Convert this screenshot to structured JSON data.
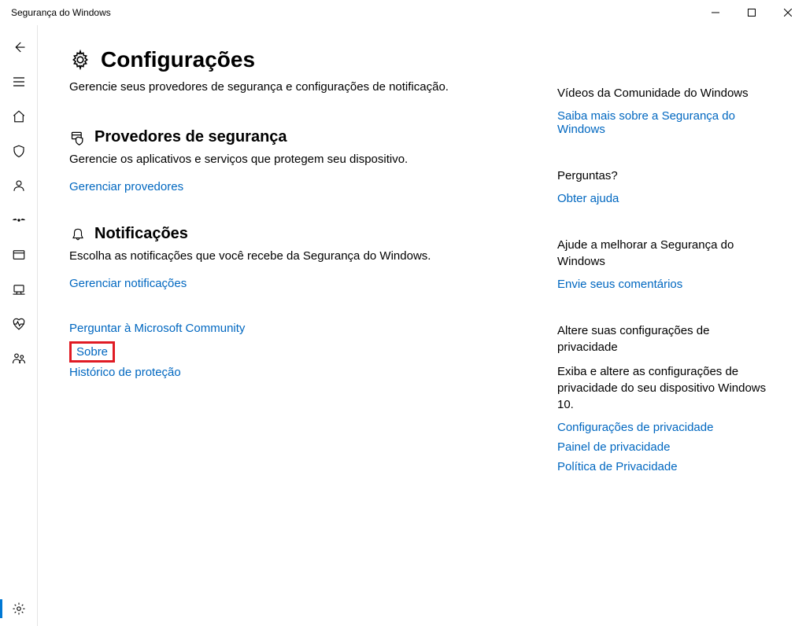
{
  "window": {
    "title": "Segurança do Windows"
  },
  "page": {
    "title": "Configurações",
    "description": "Gerencie seus provedores de segurança e configurações de notificação."
  },
  "sections": {
    "providers": {
      "heading": "Provedores de segurança",
      "description": "Gerencie os aplicativos e serviços que protegem seu dispositivo.",
      "link": "Gerenciar provedores"
    },
    "notifications": {
      "heading": "Notificações",
      "description": "Escolha as notificações que você recebe da Segurança do Windows.",
      "link": "Gerenciar notificações"
    }
  },
  "footer_links": {
    "ask_community": "Perguntar à Microsoft Community",
    "about": "Sobre",
    "protection_history": "Histórico de proteção"
  },
  "aside": {
    "videos": {
      "heading": "Vídeos da Comunidade do Windows",
      "link": "Saiba mais sobre a Segurança do Windows"
    },
    "questions": {
      "heading": "Perguntas?",
      "link": "Obter ajuda"
    },
    "feedback": {
      "heading": "Ajude a melhorar a Segurança do Windows",
      "link": "Envie seus comentários"
    },
    "privacy": {
      "heading": "Altere suas configurações de privacidade",
      "body": "Exiba e altere as configurações de privacidade do seu dispositivo Windows 10.",
      "links": {
        "settings": "Configurações de privacidade",
        "dashboard": "Painel de privacidade",
        "policy": "Política de Privacidade"
      }
    }
  }
}
